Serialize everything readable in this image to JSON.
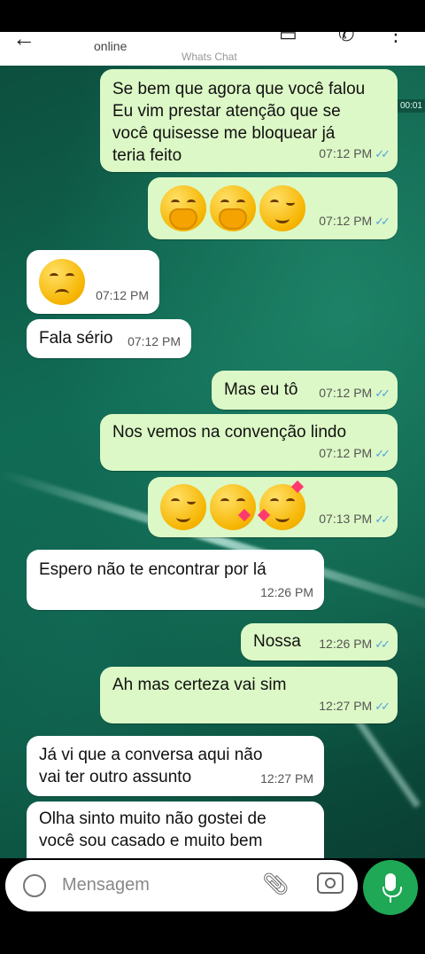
{
  "header": {
    "status": "online",
    "watermark": "Whats Chat"
  },
  "side_time": "00:01",
  "messages": [
    {
      "dir": "out",
      "lines": [
        "Se bem que agora que você falou",
        "Eu vim prestar atenção que se",
        "você quisesse me bloquear já",
        "teria feito"
      ],
      "time": "07:12 PM",
      "ticks": "✓✓"
    },
    {
      "dir": "out",
      "emojis": [
        "hand-over-mouth",
        "hand-over-mouth",
        "wink"
      ],
      "time": "07:12 PM",
      "ticks": "✓✓"
    },
    {
      "dir": "in",
      "emojis": [
        "raised-eyebrow"
      ],
      "time": "07:12 PM"
    },
    {
      "dir": "in",
      "lines": [
        "Fala sério"
      ],
      "time": "07:12 PM"
    },
    {
      "dir": "out",
      "lines": [
        "Mas eu tô"
      ],
      "time": "07:12 PM",
      "ticks": "✓✓"
    },
    {
      "dir": "out",
      "lines": [
        "Nos vemos na convenção lindo"
      ],
      "time": "07:12 PM",
      "ticks": "✓✓"
    },
    {
      "dir": "out",
      "emojis": [
        "wink",
        "kissing-heart",
        "smiling-hearts"
      ],
      "time": "07:13 PM",
      "ticks": "✓✓"
    },
    {
      "dir": "in",
      "lines": [
        "Espero não te encontrar por lá"
      ],
      "time": "12:26 PM"
    },
    {
      "dir": "out",
      "lines": [
        "Nossa"
      ],
      "time": "12:26 PM",
      "ticks": "✓✓"
    },
    {
      "dir": "out",
      "lines": [
        "Ah mas certeza vai sim"
      ],
      "time": "12:27 PM",
      "ticks": "✓✓"
    },
    {
      "dir": "in",
      "lines": [
        "Já vi que a conversa aqui não",
        "vai ter outro assunto"
      ],
      "time": "12:27 PM"
    },
    {
      "dir": "in",
      "lines": [
        "Olha sinto muito não gostei de",
        "você sou casado e muito bem"
      ]
    }
  ],
  "composer": {
    "placeholder": "Mensagem"
  },
  "colors": {
    "outgoing": "#dcf8c6",
    "incoming": "#ffffff",
    "tick": "#4fa3e0",
    "mic": "#1fa855"
  }
}
